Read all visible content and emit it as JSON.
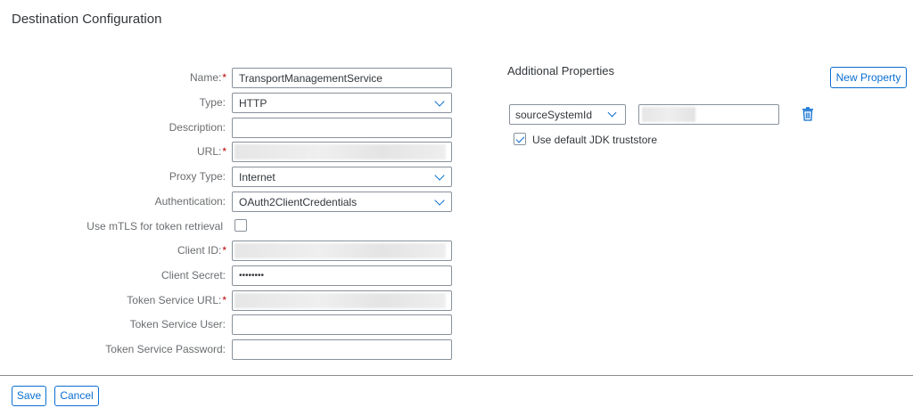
{
  "page": {
    "title": "Destination Configuration"
  },
  "form": {
    "fields": [
      {
        "label": "Name:",
        "required": true,
        "value": "TransportManagementService",
        "kind": "text"
      },
      {
        "label": "Type:",
        "required": false,
        "value": "HTTP",
        "kind": "select"
      },
      {
        "label": "Description:",
        "required": false,
        "value": "",
        "kind": "text"
      },
      {
        "label": "URL:",
        "required": true,
        "value": "",
        "kind": "blurred"
      },
      {
        "label": "Proxy Type:",
        "required": false,
        "value": "Internet",
        "kind": "select"
      },
      {
        "label": "Authentication:",
        "required": false,
        "value": "OAuth2ClientCredentials",
        "kind": "select"
      },
      {
        "label": "Use mTLS for token retrieval",
        "required": false,
        "value": "",
        "kind": "checkbox",
        "checked": false
      },
      {
        "label": "Client ID:",
        "required": true,
        "value": "",
        "kind": "blurred"
      },
      {
        "label": "Client Secret:",
        "required": false,
        "value": "••••••••",
        "kind": "password"
      },
      {
        "label": "Token Service URL:",
        "required": true,
        "value": "",
        "kind": "blurred"
      },
      {
        "label": "Token Service User:",
        "required": false,
        "value": "",
        "kind": "text"
      },
      {
        "label": "Token Service Password:",
        "required": false,
        "value": "",
        "kind": "text"
      }
    ],
    "required_marker": "*"
  },
  "additional": {
    "title": "Additional Properties",
    "new_property_label": "New Property",
    "property_key": "sourceSystemId",
    "use_jdk_label": "Use default JDK truststore",
    "use_jdk_checked": true
  },
  "footer": {
    "save_label": "Save",
    "cancel_label": "Cancel"
  },
  "colors": {
    "accent": "#0a6ed1",
    "required": "#bb0000",
    "text": "#32363a",
    "label": "#6a6d70"
  },
  "icons": {
    "delete": "trash-icon",
    "dropdown": "chevron-down-icon",
    "check": "checkmark-icon"
  }
}
